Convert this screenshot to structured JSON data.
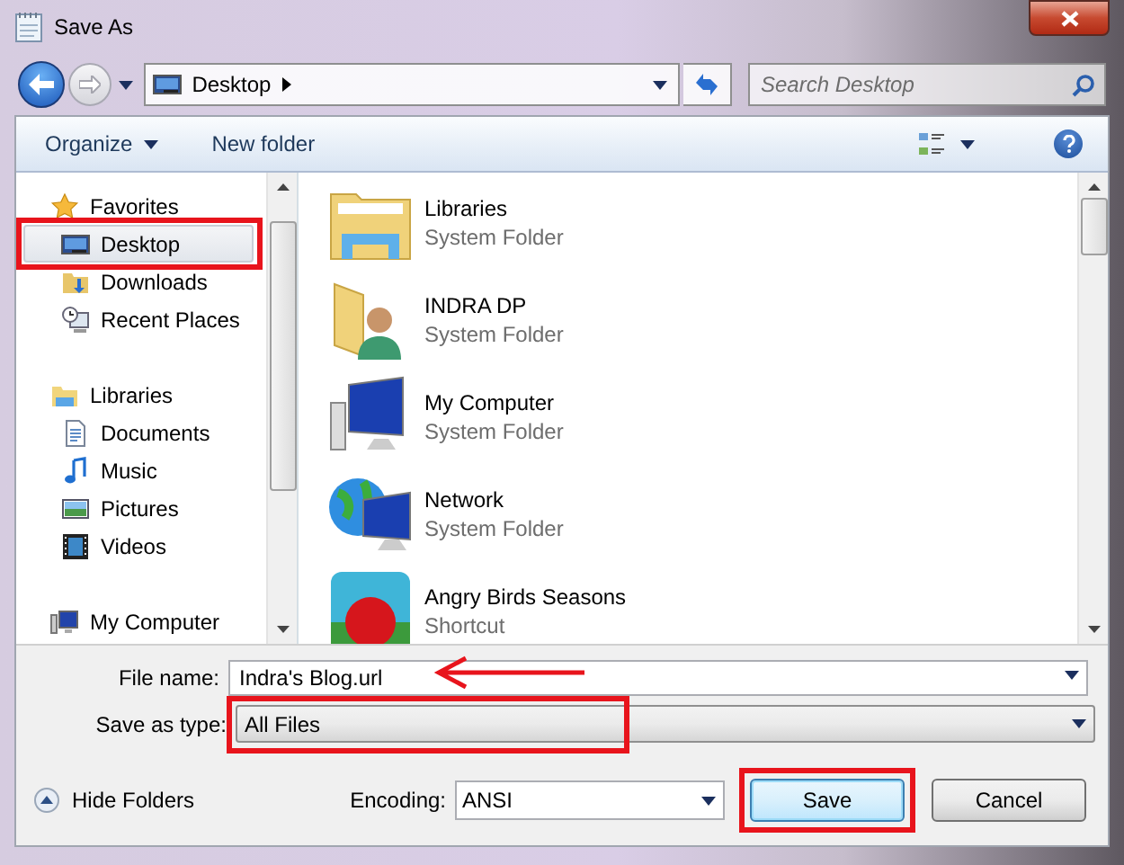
{
  "window": {
    "title": "Save As"
  },
  "address_bar": {
    "location": "Desktop"
  },
  "search": {
    "placeholder": "Search Desktop"
  },
  "toolbar": [
    {
      "label": "Organize",
      "kind": "menu"
    },
    {
      "label": "New folder",
      "kind": "button"
    }
  ],
  "navigation": [
    {
      "label": "Favorites",
      "selected": false,
      "highlighted": false,
      "children": [
        {
          "label": "Desktop",
          "selected": true,
          "highlighted": true
        },
        {
          "label": "Downloads",
          "selected": false,
          "highlighted": false
        },
        {
          "label": "Recent Places",
          "selected": false,
          "highlighted": false
        }
      ]
    },
    {
      "label": "Libraries",
      "selected": false,
      "highlighted": false,
      "children": [
        {
          "label": "Documents",
          "selected": false,
          "highlighted": false
        },
        {
          "label": "Music",
          "selected": false,
          "highlighted": false
        },
        {
          "label": "Pictures",
          "selected": false,
          "highlighted": false
        },
        {
          "label": "Videos",
          "selected": false,
          "highlighted": false
        }
      ]
    },
    {
      "label": "My Computer",
      "selected": false,
      "highlighted": false
    }
  ],
  "files": [
    {
      "name": "Libraries",
      "type": "System Folder"
    },
    {
      "name": "INDRA DP",
      "type": "System Folder"
    },
    {
      "name": "My Computer",
      "type": "System Folder"
    },
    {
      "name": "Network",
      "type": "System Folder"
    },
    {
      "name": "Angry Birds Seasons",
      "type": "Shortcut"
    }
  ],
  "file_name": {
    "label": "File name:",
    "value": "Indra's Blog.url",
    "pointed": true
  },
  "save_as_type": {
    "label": "Save as type:",
    "value": "All Files",
    "highlighted": true
  },
  "hide_folders": "Hide Folders",
  "encoding": {
    "label": "Encoding:",
    "value": "ANSI"
  },
  "buttons": [
    {
      "label": "Save",
      "default": true,
      "highlighted": true
    },
    {
      "label": "Cancel",
      "default": false,
      "highlighted": false
    }
  ]
}
